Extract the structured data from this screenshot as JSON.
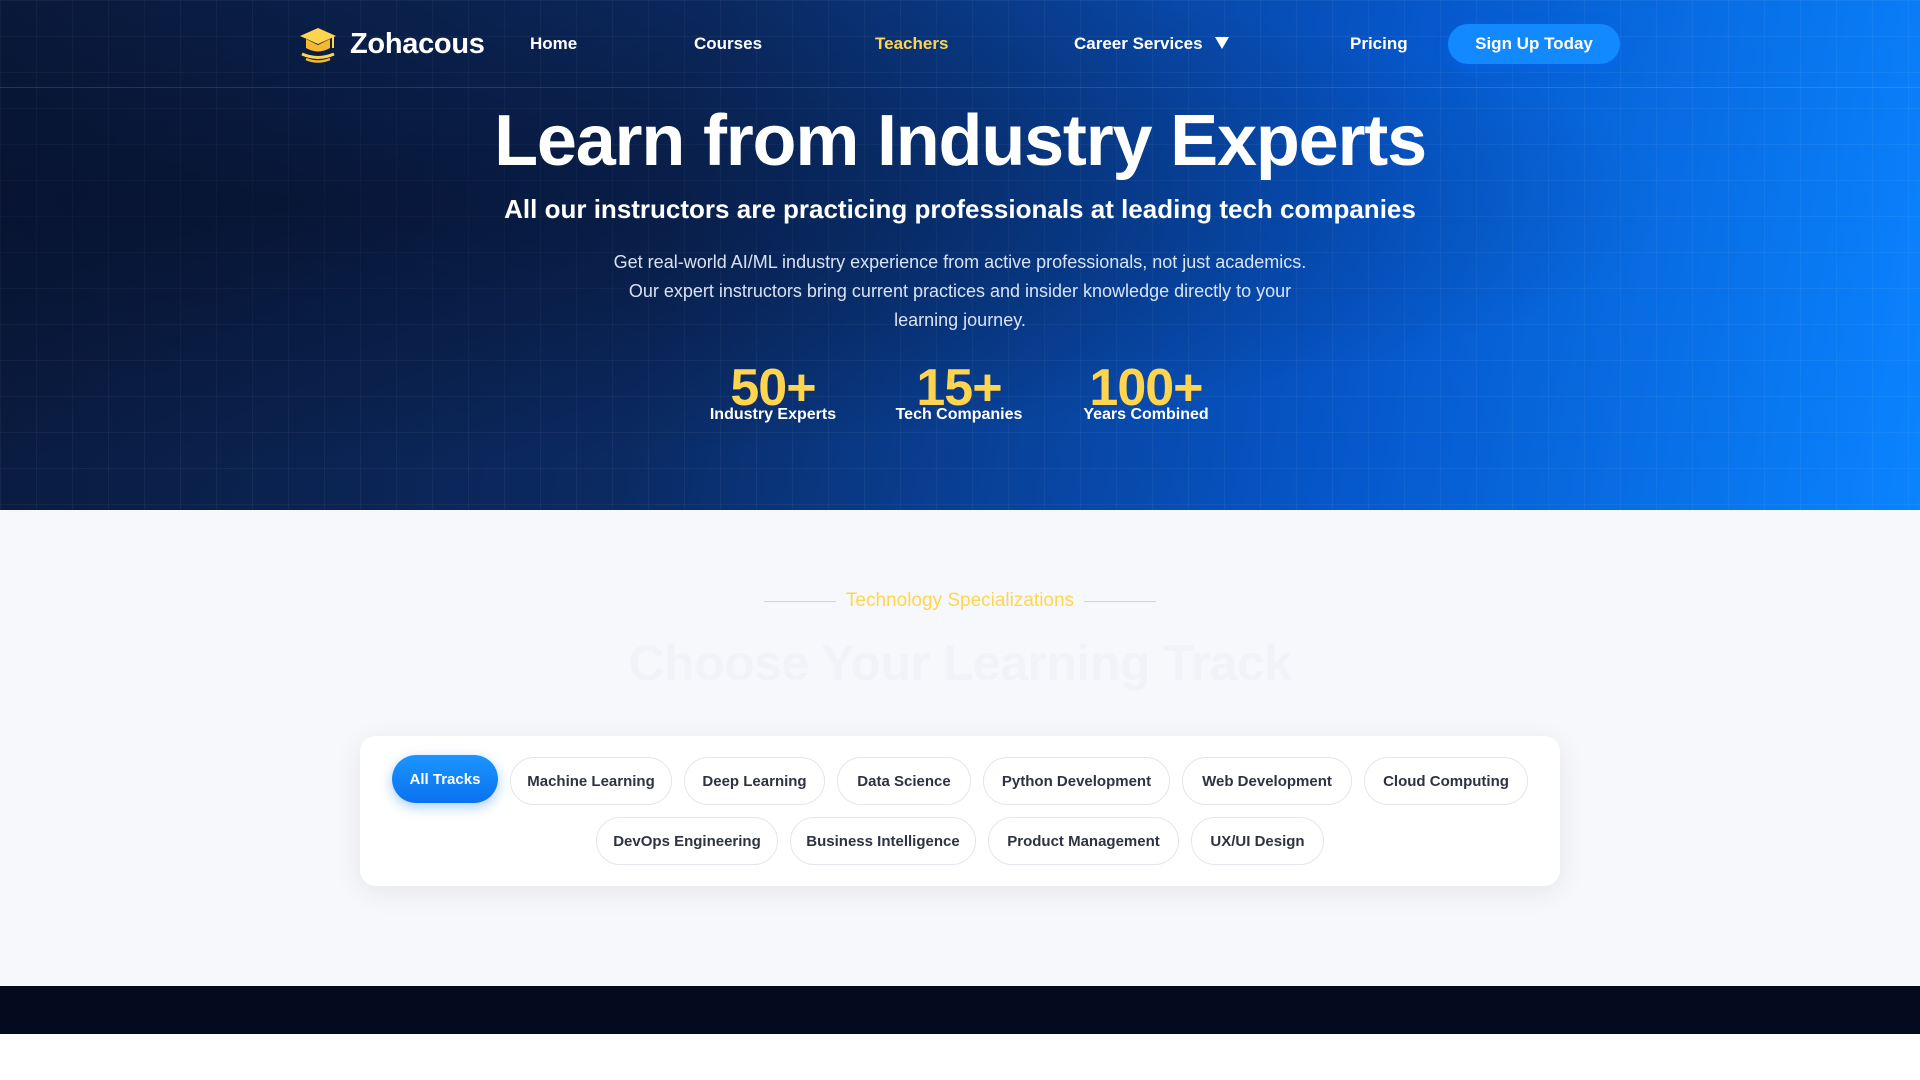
{
  "nav": {
    "brand": "Zohacous",
    "links": [
      "Home",
      "Courses",
      "Teachers",
      "Career Services",
      "Pricing"
    ],
    "active": "Teachers",
    "cta": "Sign Up Today"
  },
  "hero": {
    "title": "Learn from Industry Experts",
    "subtitle": "All our instructors are practicing professionals at leading tech companies",
    "description": "Get real-world AI/ML industry experience from active professionals, not just academics. Our expert instructors bring current practices and insider knowledge directly to your learning journey.",
    "stats": [
      {
        "value": "50+",
        "label": "Industry Experts"
      },
      {
        "value": "15+",
        "label": "Tech Companies"
      },
      {
        "value": "100+",
        "label": "Years Combined"
      }
    ]
  },
  "tracks": {
    "kicker": "Technology Specializations",
    "title": "Choose Your Learning Track",
    "chips": [
      "All Tracks",
      "Machine Learning",
      "Deep Learning",
      "Data Science",
      "Python Development",
      "Web Development",
      "Cloud Computing",
      "DevOps Engineering",
      "Business Intelligence",
      "Product Management",
      "UX/UI Design"
    ],
    "active": "All Tracks"
  },
  "colors": {
    "accent": "#ffd54f",
    "primary": "#1289ff",
    "hero_dark": "#0a1a3c",
    "footer": "#060a1f"
  },
  "icons": {
    "brand": "graduation-cap-icon",
    "dropdown": "caret-down-icon"
  }
}
